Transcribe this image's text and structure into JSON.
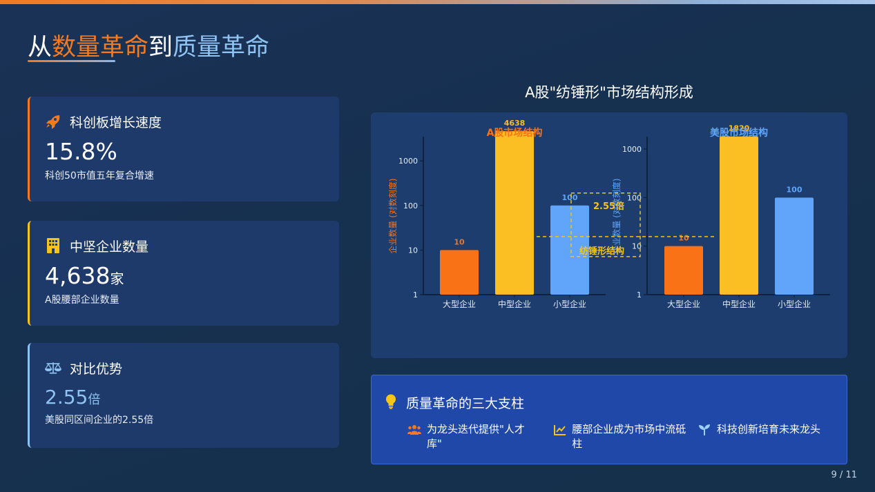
{
  "page": {
    "title_parts": [
      "从",
      "数量革命",
      "到",
      "质量革命"
    ],
    "page_number": "9 / 11"
  },
  "cards": [
    {
      "icon": "rocket-icon",
      "title": "科创板增长速度",
      "value": "15.8%",
      "unit": "",
      "desc": "科创50市值五年复合增速",
      "accent": "#f47a20"
    },
    {
      "icon": "building-icon",
      "title": "中坚企业数量",
      "value": "4,638",
      "unit": "家",
      "desc": "A股腰部企业数量",
      "accent": "#f5c518"
    },
    {
      "icon": "balance-scale-icon",
      "title": "对比优势",
      "value": "2.55",
      "unit": "倍",
      "desc": "美股同区间企业的2.55倍",
      "accent": "#8fc3f2"
    }
  ],
  "chart_heading": "A股\"纺锤形\"市场结构形成",
  "chart_data": [
    {
      "type": "bar",
      "title": "A股市场结构",
      "ylabel": "企业数量 (对数刻度)",
      "yscale": "log",
      "ylim": [
        1,
        5000
      ],
      "yticks": [
        "1",
        "10",
        "100",
        "1000"
      ],
      "categories": [
        "大型企业",
        "中型企业",
        "小型企业"
      ],
      "values": [
        10,
        4638,
        100
      ],
      "value_labels": [
        "10",
        "4638",
        "100"
      ],
      "colors": [
        "#f97316",
        "#fbbf24",
        "#60a5fa"
      ]
    },
    {
      "type": "bar",
      "title": "美股市场结构",
      "ylabel": "企业数量 (对数刻度)",
      "yscale": "log",
      "ylim": [
        1,
        2500
      ],
      "yticks": [
        "1",
        "10",
        "100",
        "1000"
      ],
      "categories": [
        "大型企业",
        "中型企业",
        "小型企业"
      ],
      "values": [
        10,
        1820,
        100
      ],
      "value_labels": [
        "10",
        "1820",
        "100"
      ],
      "colors": [
        "#f97316",
        "#fbbf24",
        "#60a5fa"
      ]
    }
  ],
  "annotations": {
    "ratio": "2.55倍",
    "shape": "纺锤形结构",
    "color": "#f5c518"
  },
  "pillars": {
    "title": "质量革命的三大支柱",
    "items": [
      {
        "icon": "people-icon",
        "text": "为龙头迭代提供\"人才库\""
      },
      {
        "icon": "line-chart-icon",
        "text": "腰部企业成为市场中流砥柱"
      },
      {
        "icon": "seedling-icon",
        "text": "科技创新培育未来龙头"
      }
    ]
  }
}
